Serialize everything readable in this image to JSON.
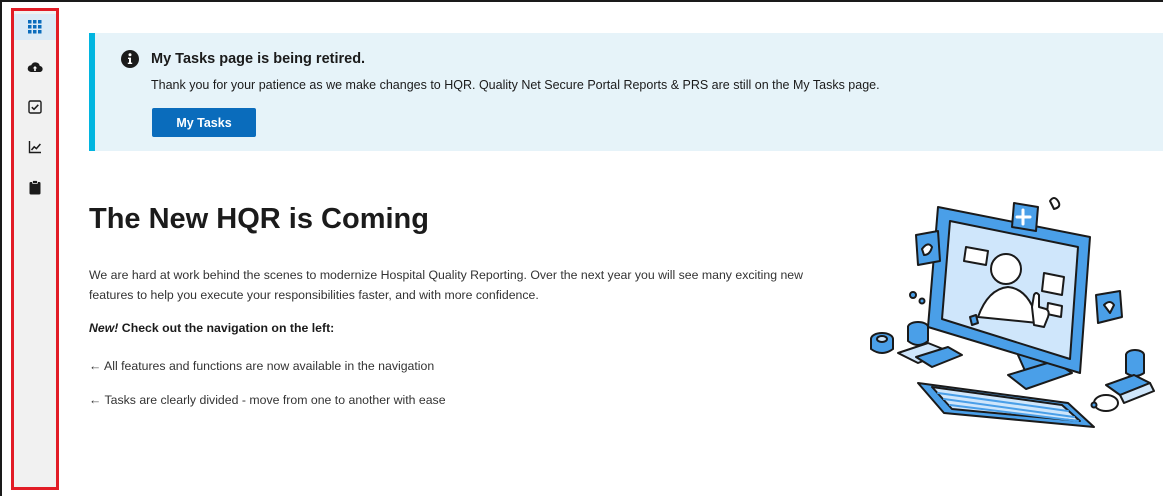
{
  "sidebar": {
    "items": [
      {
        "icon": "grid-icon",
        "active": true
      },
      {
        "icon": "cloud-upload-icon",
        "active": false
      },
      {
        "icon": "checkbox-icon",
        "active": false
      },
      {
        "icon": "chart-line-icon",
        "active": false
      },
      {
        "icon": "clipboard-icon",
        "active": false
      }
    ]
  },
  "banner": {
    "icon": "info-icon",
    "title": "My Tasks page is being retired.",
    "text": "Thank you for your patience as we make changes to HQR. Quality Net Secure Portal Reports & PRS are still on the My Tasks page.",
    "button_label": "My Tasks"
  },
  "main": {
    "title": "The New HQR is Coming",
    "intro": "We are hard at work behind the scenes to modernize Hospital Quality Reporting. Over the next year you will see many exciting new features to help you execute your responsibilities faster, and with more confidence.",
    "callout_new": "New!",
    "callout_rest": " Check out the navigation on the left:",
    "bullets": [
      "← All features and functions are now available in the navigation",
      "← Tasks are clearly divided - move from one to another with ease"
    ]
  },
  "colors": {
    "accent": "#0a6cbc",
    "banner_bg": "#e6f3f9",
    "banner_border": "#01b5e0",
    "highlight": "#e21c26",
    "illustration_blue": "#4a9fe8"
  }
}
